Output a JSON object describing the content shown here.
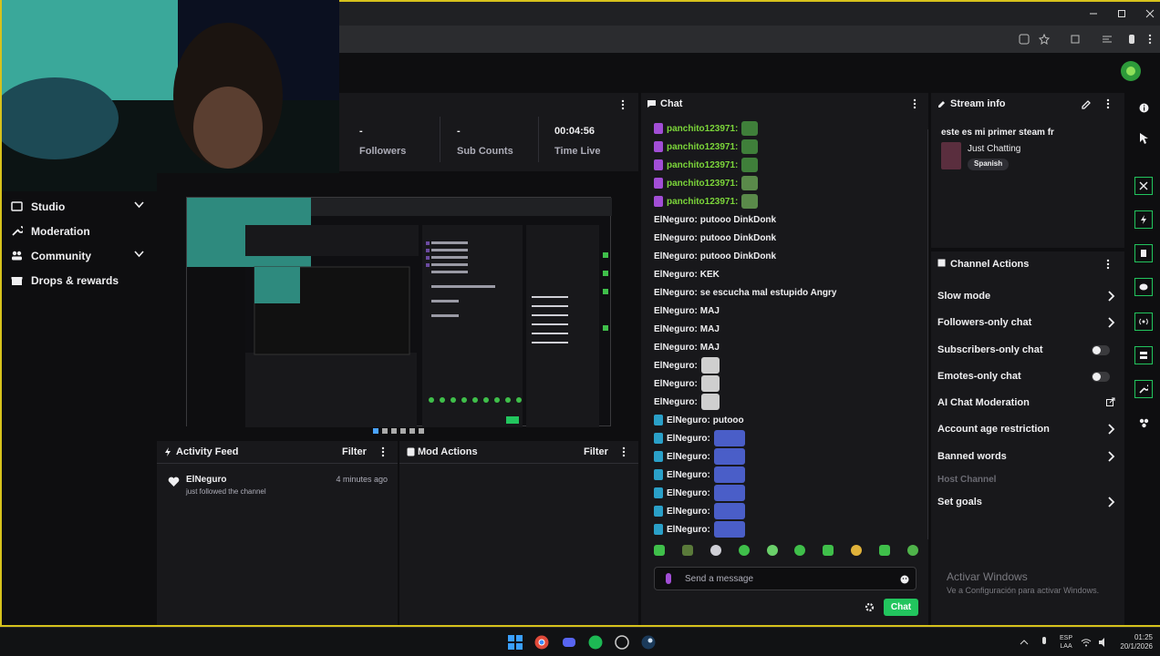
{
  "sidebar": {
    "items": [
      {
        "label": "Studio",
        "icon": "studio-icon",
        "expandable": true
      },
      {
        "label": "Moderation",
        "icon": "wrench-icon",
        "expandable": false
      },
      {
        "label": "Community",
        "icon": "people-icon",
        "expandable": true
      },
      {
        "label": "Drops & rewards",
        "icon": "gift-icon",
        "expandable": false
      }
    ]
  },
  "stats": [
    {
      "value": "-",
      "label": "Followers"
    },
    {
      "value": "-",
      "label": "Sub Counts"
    },
    {
      "value": "00:04:56",
      "label": "Time Live"
    }
  ],
  "activity_feed": {
    "title": "Activity Feed",
    "filter": "Filter",
    "event": {
      "user": "ElNeguro",
      "action": "just followed the channel",
      "time": "4 minutes ago"
    }
  },
  "mod_actions": {
    "title": "Mod Actions",
    "filter": "Filter"
  },
  "chat": {
    "title": "Chat",
    "messages": [
      {
        "user": "panchito123971:",
        "text": "",
        "user_color": "#7cd63a",
        "badge": "mic",
        "emote": "pepe"
      },
      {
        "user": "panchito123971:",
        "text": "",
        "user_color": "#7cd63a",
        "badge": "mic",
        "emote": "pepe"
      },
      {
        "user": "panchito123971:",
        "text": "",
        "user_color": "#7cd63a",
        "badge": "mic",
        "emote": "pepe"
      },
      {
        "user": "panchito123971:",
        "text": "",
        "user_color": "#7cd63a",
        "badge": "mic",
        "emote": "pepe-big"
      },
      {
        "user": "panchito123971:",
        "text": "",
        "user_color": "#7cd63a",
        "badge": "mic",
        "emote": "pepe-big"
      },
      {
        "user": "ElNeguro:",
        "text": "putooo DinkDonk",
        "user_color": "#efeff1",
        "badge": "",
        "emote": ""
      },
      {
        "user": "ElNeguro:",
        "text": "putooo DinkDonk",
        "user_color": "#efeff1",
        "badge": "",
        "emote": ""
      },
      {
        "user": "ElNeguro:",
        "text": "putooo DinkDonk",
        "user_color": "#efeff1",
        "badge": "",
        "emote": ""
      },
      {
        "user": "ElNeguro:",
        "text": "KEK",
        "user_color": "#efeff1",
        "badge": "",
        "emote": ""
      },
      {
        "user": "ElNeguro:",
        "text": "se escucha mal estupido Angry",
        "user_color": "#efeff1",
        "badge": "",
        "emote": ""
      },
      {
        "user": "ElNeguro:",
        "text": "MAJ",
        "user_color": "#efeff1",
        "badge": "",
        "emote": ""
      },
      {
        "user": "ElNeguro:",
        "text": "MAJ",
        "user_color": "#efeff1",
        "badge": "",
        "emote": ""
      },
      {
        "user": "ElNeguro:",
        "text": "MAJ",
        "user_color": "#efeff1",
        "badge": "",
        "emote": ""
      },
      {
        "user": "ElNeguro:",
        "text": "",
        "user_color": "#efeff1",
        "badge": "",
        "emote": "face"
      },
      {
        "user": "ElNeguro:",
        "text": "",
        "user_color": "#efeff1",
        "badge": "",
        "emote": "face"
      },
      {
        "user": "ElNeguro:",
        "text": "",
        "user_color": "#efeff1",
        "badge": "",
        "emote": "face"
      },
      {
        "user": "ElNeguro:",
        "text": "putooo",
        "user_color": "#efeff1",
        "badge": "sword",
        "emote": ""
      },
      {
        "user": "ElNeguro:",
        "text": "",
        "user_color": "#efeff1",
        "badge": "sword",
        "emote": "anime"
      },
      {
        "user": "ElNeguro:",
        "text": "",
        "user_color": "#efeff1",
        "badge": "sword",
        "emote": "anime"
      },
      {
        "user": "ElNeguro:",
        "text": "",
        "user_color": "#efeff1",
        "badge": "sword",
        "emote": "anime"
      },
      {
        "user": "ElNeguro:",
        "text": "",
        "user_color": "#efeff1",
        "badge": "sword",
        "emote": "anime"
      },
      {
        "user": "ElNeguro:",
        "text": "",
        "user_color": "#efeff1",
        "badge": "sword",
        "emote": "anime"
      },
      {
        "user": "ElNeguro:",
        "text": "",
        "user_color": "#efeff1",
        "badge": "sword",
        "emote": "anime"
      }
    ],
    "placeholder": "Send a message",
    "send_label": "Chat"
  },
  "stream_info": {
    "title": "Stream info",
    "stream_title": "este es mi primer steam fr",
    "category": "Just Chatting",
    "tag": "Spanish"
  },
  "channel_actions": {
    "title": "Channel Actions",
    "items": [
      {
        "label": "Slow mode",
        "control": "arrow"
      },
      {
        "label": "Followers-only chat",
        "control": "arrow"
      },
      {
        "label": "Subscribers-only chat",
        "control": "toggle"
      },
      {
        "label": "Emotes-only chat",
        "control": "toggle"
      },
      {
        "label": "AI Chat Moderation",
        "control": "external"
      },
      {
        "label": "Account age restriction",
        "control": "arrow"
      },
      {
        "label": "Banned words",
        "control": "arrow"
      },
      {
        "label": "Host Channel",
        "control": "none"
      },
      {
        "label": "Set goals",
        "control": "arrow"
      }
    ]
  },
  "watermark": {
    "title": "Activar Windows",
    "subtitle": "Ve a Configuración para activar Windows."
  },
  "taskbar": {
    "lang": "ESP",
    "lang2": "LAA",
    "time": "01:25",
    "date": "20/1/2026"
  },
  "colors": {
    "accent": "#22c55e",
    "bg": "#0e0e10",
    "panel": "#18181b",
    "frame": "#d6c21c"
  }
}
